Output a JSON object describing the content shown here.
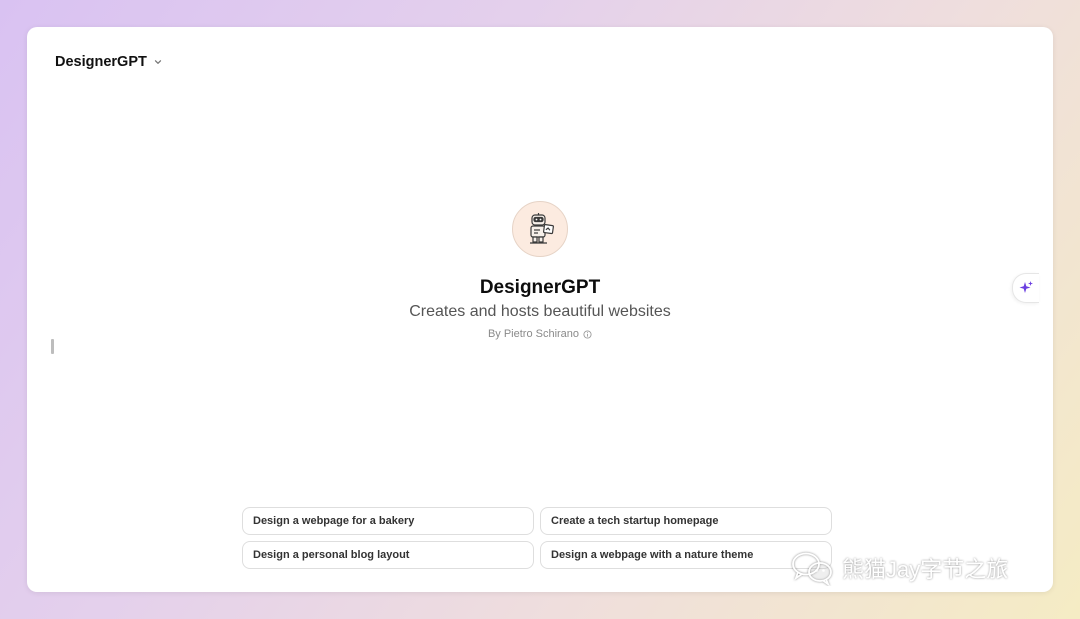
{
  "header": {
    "model_name": "DesignerGPT",
    "dropdown_icon": "chevron-down-icon"
  },
  "gpt": {
    "avatar_icon": "robot-artist-icon",
    "title": "DesignerGPT",
    "description": "Creates and hosts beautiful websites",
    "author": "By Pietro Schirano",
    "author_info_icon": "info-icon"
  },
  "side_button": {
    "icon": "sparkles-icon",
    "accent_color": "#6b3fe0"
  },
  "suggestions": [
    "Design a webpage for a bakery",
    "Create a tech startup homepage",
    "Design a personal blog layout",
    "Design a webpage with a nature theme"
  ],
  "watermark": {
    "text": "熊猫Jay字节之旅",
    "icon": "wechat-icon"
  }
}
